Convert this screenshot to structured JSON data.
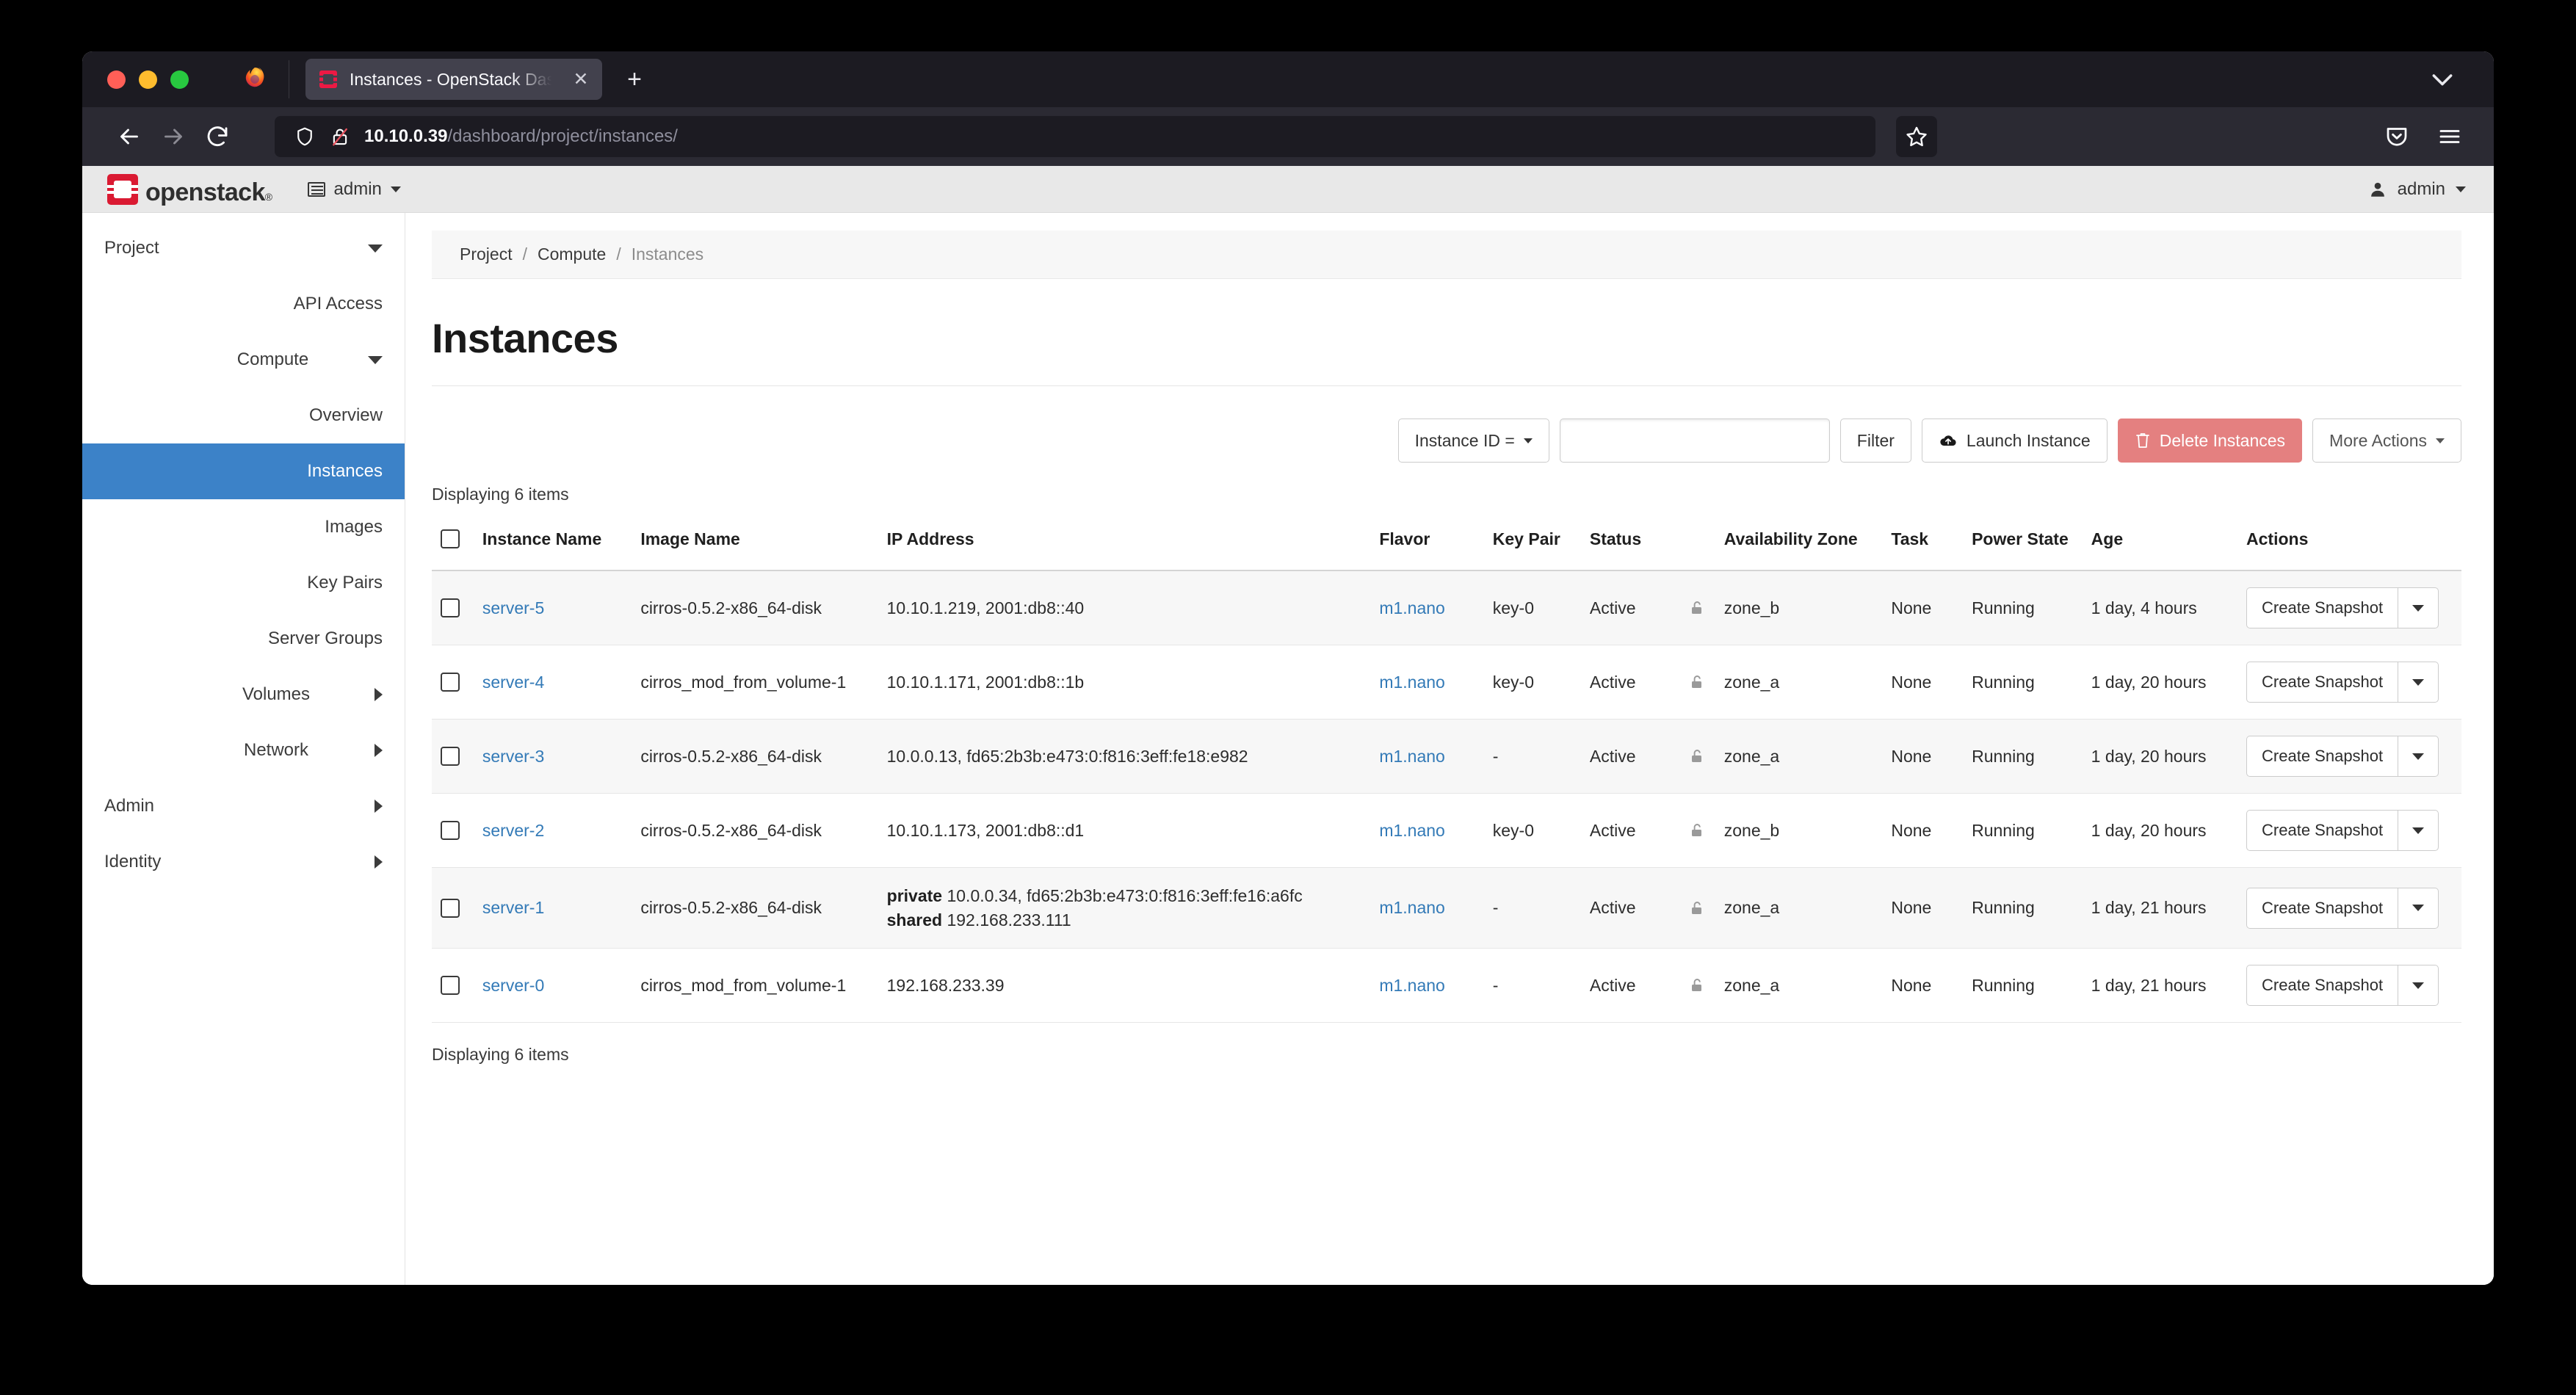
{
  "browser": {
    "tab": {
      "title": "Instances - OpenStack Dashboard",
      "favicon_name": "openstack-favicon",
      "close_glyph": "✕"
    },
    "newtab_glyph": "+",
    "back_glyph": "←",
    "forward_glyph": "→",
    "reload_glyph": "↻",
    "url": {
      "host": "10.10.0.39",
      "path": "/dashboard/project/instances/",
      "shield_name": "tracking-protection-shield-icon",
      "lock_name": "insecure-padlock-icon"
    },
    "star_glyph": "☆",
    "pocket_name": "pocket-icon",
    "menu_name": "hamburger-menu-icon",
    "tablist_chevron_name": "list-all-tabs-chevron"
  },
  "header": {
    "logo_text": "openstack",
    "logo_sup": "®",
    "project_label": "admin",
    "user_label": "admin",
    "user_glyph": "♟"
  },
  "sidebar": {
    "items": [
      {
        "label": "Project",
        "level": 0,
        "chevron": "down",
        "active": false
      },
      {
        "label": "API Access",
        "level": 2,
        "chevron": "none",
        "active": false
      },
      {
        "label": "Compute",
        "level": 1,
        "chevron": "down",
        "active": false
      },
      {
        "label": "Overview",
        "level": 2,
        "chevron": "none",
        "active": false
      },
      {
        "label": "Instances",
        "level": 2,
        "chevron": "none",
        "active": true
      },
      {
        "label": "Images",
        "level": 2,
        "chevron": "none",
        "active": false
      },
      {
        "label": "Key Pairs",
        "level": 2,
        "chevron": "none",
        "active": false
      },
      {
        "label": "Server Groups",
        "level": 2,
        "chevron": "none",
        "active": false
      },
      {
        "label": "Volumes",
        "level": 1,
        "chevron": "right",
        "active": false
      },
      {
        "label": "Network",
        "level": 1,
        "chevron": "right",
        "active": false
      },
      {
        "label": "Admin",
        "level": 0,
        "chevron": "right",
        "active": false
      },
      {
        "label": "Identity",
        "level": 0,
        "chevron": "right",
        "active": false
      }
    ]
  },
  "breadcrumb": [
    {
      "label": "Project",
      "current": false
    },
    {
      "label": "Compute",
      "current": false
    },
    {
      "label": "Instances",
      "current": true
    }
  ],
  "page_title": "Instances",
  "toolbar": {
    "filter_select_label": "Instance ID =",
    "filter_input_value": "",
    "filter_input_placeholder": "",
    "filter_button": "Filter",
    "launch_instance": "Launch Instance",
    "launch_icon": "☁",
    "delete_instances": "Delete Instances",
    "delete_icon": "Ὕ1",
    "more_actions": "More Actions"
  },
  "count_top": "Displaying 6 items",
  "count_bottom": "Displaying 6 items",
  "table": {
    "columns": [
      "",
      "Instance Name",
      "Image Name",
      "IP Address",
      "Flavor",
      "Key Pair",
      "Status",
      "",
      "Availability Zone",
      "Task",
      "Power State",
      "Age",
      "Actions"
    ],
    "action_label": "Create Snapshot",
    "rows": [
      {
        "name": "server-5",
        "image": "cirros-0.5.2-x86_64-disk",
        "ips": [
          {
            "net": "",
            "addr": "10.10.1.219, 2001:db8::40"
          }
        ],
        "flavor": "m1.nano",
        "key_pair": "key-0",
        "status": "Active",
        "lock": "unlocked",
        "zone": "zone_b",
        "task": "None",
        "power": "Running",
        "age": "1 day, 4 hours"
      },
      {
        "name": "server-4",
        "image": "cirros_mod_from_volume-1",
        "ips": [
          {
            "net": "",
            "addr": "10.10.1.171, 2001:db8::1b"
          }
        ],
        "flavor": "m1.nano",
        "key_pair": "key-0",
        "status": "Active",
        "lock": "unlocked",
        "zone": "zone_a",
        "task": "None",
        "power": "Running",
        "age": "1 day, 20 hours"
      },
      {
        "name": "server-3",
        "image": "cirros-0.5.2-x86_64-disk",
        "ips": [
          {
            "net": "",
            "addr": "10.0.0.13, fd65:2b3b:e473:0:f816:3eff:fe18:e982"
          }
        ],
        "flavor": "m1.nano",
        "key_pair": "-",
        "status": "Active",
        "lock": "unlocked",
        "zone": "zone_a",
        "task": "None",
        "power": "Running",
        "age": "1 day, 20 hours"
      },
      {
        "name": "server-2",
        "image": "cirros-0.5.2-x86_64-disk",
        "ips": [
          {
            "net": "",
            "addr": "10.10.1.173, 2001:db8::d1"
          }
        ],
        "flavor": "m1.nano",
        "key_pair": "key-0",
        "status": "Active",
        "lock": "unlocked",
        "zone": "zone_b",
        "task": "None",
        "power": "Running",
        "age": "1 day, 20 hours"
      },
      {
        "name": "server-1",
        "image": "cirros-0.5.2-x86_64-disk",
        "ips": [
          {
            "net": "private",
            "addr": "10.0.0.34, fd65:2b3b:e473:0:f816:3eff:fe16:a6fc"
          },
          {
            "net": "shared",
            "addr": "192.168.233.111"
          }
        ],
        "flavor": "m1.nano",
        "key_pair": "-",
        "status": "Active",
        "lock": "unlocked",
        "zone": "zone_a",
        "task": "None",
        "power": "Running",
        "age": "1 day, 21 hours"
      },
      {
        "name": "server-0",
        "image": "cirros_mod_from_volume-1",
        "ips": [
          {
            "net": "",
            "addr": "192.168.233.39"
          }
        ],
        "flavor": "m1.nano",
        "key_pair": "-",
        "status": "Active",
        "lock": "unlocked",
        "zone": "zone_a",
        "task": "None",
        "power": "Running",
        "age": "1 day, 21 hours"
      }
    ]
  },
  "colors": {
    "accent_blue": "#337ab7",
    "active_nav": "#3c82c8",
    "danger_red": "#e48080",
    "brand_red": "#da1a32"
  }
}
